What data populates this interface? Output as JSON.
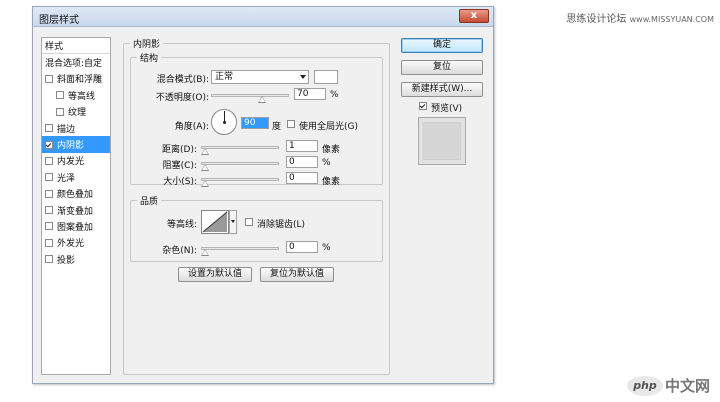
{
  "watermark": {
    "top_text": "思练设计论坛",
    "top_url": "www.MISSYUAN.COM",
    "bottom_logo": "php",
    "bottom_text": "中文网"
  },
  "dialog": {
    "title": "图层样式",
    "close_glyph": "x"
  },
  "styles_panel": {
    "header": "样式",
    "blend_options": "混合选项:自定",
    "items": [
      {
        "label": "斜面和浮雕",
        "checked": false,
        "sub": false
      },
      {
        "label": "等高线",
        "checked": false,
        "sub": true
      },
      {
        "label": "纹理",
        "checked": false,
        "sub": true
      },
      {
        "label": "描边",
        "checked": false,
        "sub": false
      },
      {
        "label": "内阴影",
        "checked": true,
        "sub": false,
        "selected": true
      },
      {
        "label": "内发光",
        "checked": false,
        "sub": false
      },
      {
        "label": "光泽",
        "checked": false,
        "sub": false
      },
      {
        "label": "颜色叠加",
        "checked": false,
        "sub": false
      },
      {
        "label": "渐变叠加",
        "checked": false,
        "sub": false
      },
      {
        "label": "图案叠加",
        "checked": false,
        "sub": false
      },
      {
        "label": "外发光",
        "checked": false,
        "sub": false
      },
      {
        "label": "投影",
        "checked": false,
        "sub": false
      }
    ]
  },
  "inner_shadow": {
    "section_title": "内阴影",
    "structure": {
      "title": "结构",
      "blend_mode_label": "混合模式(B):",
      "blend_mode_value": "正常",
      "opacity_label": "不透明度(O):",
      "opacity_value": "70",
      "opacity_unit": "%",
      "angle_label": "角度(A):",
      "angle_value": "90",
      "angle_unit": "度",
      "global_light_label": "使用全局光(G)",
      "global_light_checked": false,
      "distance_label": "距离(D):",
      "distance_value": "1",
      "distance_unit": "像素",
      "choke_label": "阻塞(C):",
      "choke_value": "0",
      "choke_unit": "%",
      "size_label": "大小(S):",
      "size_value": "0",
      "size_unit": "像素"
    },
    "quality": {
      "title": "品质",
      "contour_label": "等高线:",
      "anti_alias_label": "消除锯齿(L)",
      "anti_alias_checked": false,
      "noise_label": "杂色(N):",
      "noise_value": "0",
      "noise_unit": "%"
    },
    "make_default": "设置为默认值",
    "reset_default": "复位为默认值"
  },
  "actions": {
    "ok": "确定",
    "reset": "复位",
    "new_style": "新建样式(W)...",
    "preview_label": "预览(V)",
    "preview_checked": true
  }
}
